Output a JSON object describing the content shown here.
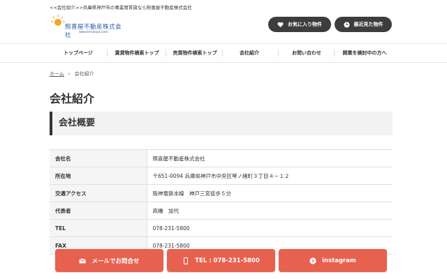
{
  "header": {
    "topline": "<<会社紹介>>兵庫県神戸市の事業用賃貸なら照喜屋不動産株式会社",
    "logo_name": "照喜屋不動産株式会社",
    "logo_url": "www.terukiya.com",
    "favorites_label": "お気に入り物件",
    "recent_label": "最近見た物件"
  },
  "nav": {
    "items": [
      "トップページ",
      "賃貸物件検索トップ",
      "売買物件検索トップ",
      "会社紹介",
      "お問い合わせ",
      "開業を検討中の方へ"
    ]
  },
  "breadcrumb": {
    "home": "ホーム",
    "current": "会社紹介"
  },
  "page": {
    "title": "会社紹介",
    "section_title": "会社概要"
  },
  "company": {
    "rows": [
      {
        "label": "会社名",
        "value": "照喜屋不動産株式会社"
      },
      {
        "label": "所在地",
        "value": "〒651-0094 兵庫県神戸市中央区琴ノ緒町３丁目４－１２"
      },
      {
        "label": "交通アクセス",
        "value": "阪神電鉄本線　神戸三宮徒歩５分"
      },
      {
        "label": "代表者",
        "value": "高橋　加代"
      },
      {
        "label": "TEL",
        "value": "078-231-5800"
      },
      {
        "label": "FAX",
        "value": "078-231-5800"
      }
    ]
  },
  "cta": {
    "mail_label": "メールでお問合せ",
    "tel_label": "TEL : 078-231-5800",
    "instagram_label": "instagram"
  },
  "colors": {
    "accent": "#e8614e",
    "dark_pill": "#3d3d3d",
    "logo_blue": "#2a5aa8"
  }
}
